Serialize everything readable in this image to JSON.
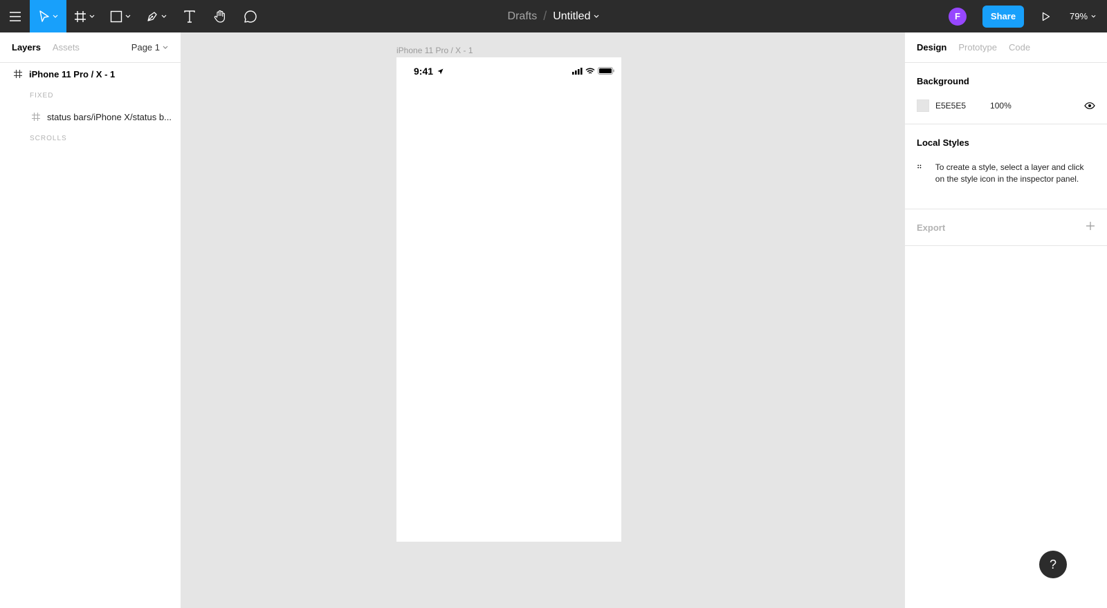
{
  "toolbar": {
    "breadcrumb_parent": "Drafts",
    "breadcrumb_sep": "/",
    "file_title": "Untitled",
    "avatar_initial": "F",
    "share_label": "Share",
    "zoom_label": "79%",
    "tools": [
      "move-tool",
      "frame-tool",
      "shape-tool",
      "pen-tool",
      "text-tool",
      "hand-tool",
      "comment-tool"
    ]
  },
  "left_panel": {
    "tabs": [
      "Layers",
      "Assets"
    ],
    "page_select": "Page 1",
    "layers": {
      "top_frame": "iPhone 11 Pro / X - 1",
      "section_fixed": "FIXED",
      "child_layer": "status bars/iPhone X/status b...",
      "section_scrolls": "SCROLLS"
    }
  },
  "canvas": {
    "frame_label": "iPhone 11 Pro / X - 1",
    "status_time": "9:41"
  },
  "right_panel": {
    "tabs": [
      "Design",
      "Prototype",
      "Code"
    ],
    "background_heading": "Background",
    "background_hex": "E5E5E5",
    "background_opacity": "100%",
    "background_color": "#E5E5E5",
    "local_styles_heading": "Local Styles",
    "local_styles_hint": "To create a style, select a layer and click on the style icon in the inspector panel.",
    "export_heading": "Export"
  },
  "help_label": "?",
  "colors": {
    "toolbar_bg": "#2c2c2c",
    "accent": "#18a0fb",
    "avatar": "#9747ff"
  }
}
